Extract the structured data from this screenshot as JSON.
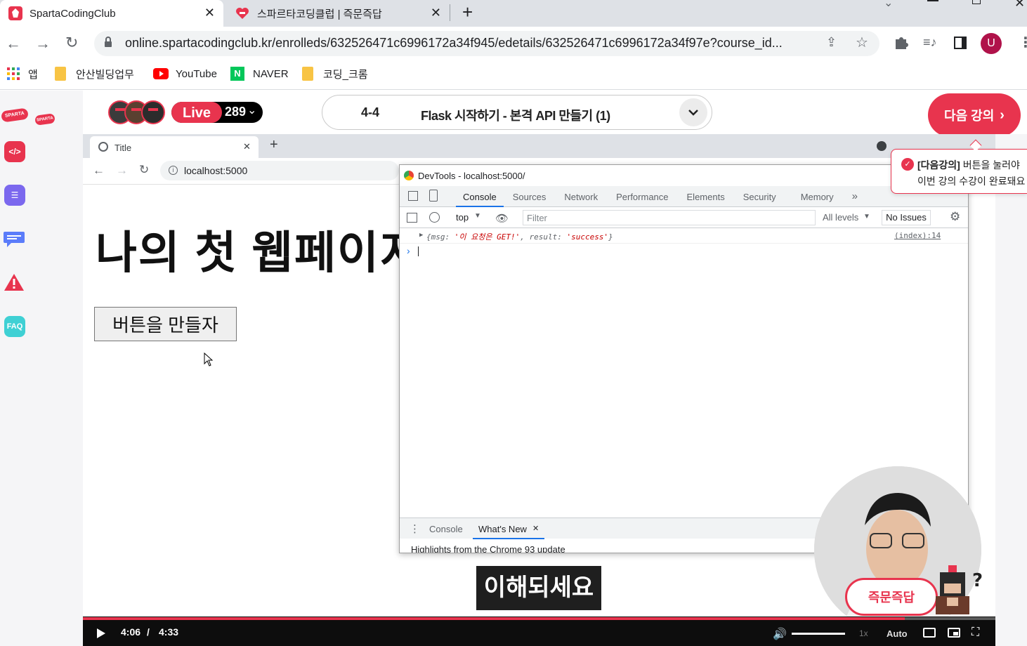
{
  "browser": {
    "tabs": [
      {
        "title": "SpartaCodingClub",
        "icon": "sparta-favicon"
      },
      {
        "title": "스파르타코딩클럽 | 즉문즉답",
        "icon": "heart-chat-favicon"
      }
    ],
    "url": "online.spartacodingclub.kr/enrolleds/632526471c6996172a34f945/edetails/632526471c6996172a34f97e?course_id...",
    "avatar_letter": "U",
    "bookmarks": [
      "앱",
      "안산빌딩업무",
      "YouTube",
      "NAVER",
      "코딩_크롬"
    ]
  },
  "sidebar": {
    "logo_text": "SPARTA",
    "faq_label": "FAQ"
  },
  "header": {
    "live_label": "Live",
    "live_count": "289",
    "lesson_number": "4-4",
    "lesson_title": "Flask 시작하기 - 본격 API 만들기 (1)",
    "next_button": "다음 강의"
  },
  "tooltip": {
    "line1_bold": "[다음강의]",
    "line1_rest": " 버튼을 눌러야",
    "line2": "이번 강의 수강이 완료돼요"
  },
  "inner_browser": {
    "tab_title": "Title",
    "url": "localhost:5000",
    "heading": "나의 첫 웹페이지",
    "button_label": "버튼을 만들자"
  },
  "devtools": {
    "title": "DevTools - localhost:5000/",
    "tabs": [
      "Console",
      "Sources",
      "Network",
      "Performance",
      "Elements",
      "Security",
      "Memory"
    ],
    "context": "top",
    "filter_placeholder": "Filter",
    "levels": "All levels",
    "issues": "No Issues",
    "log_pre": "{msg: ",
    "log_msg": "'이 요청은 GET!'",
    "log_mid": ", result: ",
    "log_result": "'success'",
    "log_post": "}",
    "log_source": "(index):14",
    "drawer_tabs": [
      "Console",
      "What's New"
    ],
    "drawer_text": "Highlights from the Chrome 93 update"
  },
  "player": {
    "subtitle": "이해되세요",
    "current_time": "4:06",
    "separator": "/",
    "duration": "4:33",
    "progress": 0.901,
    "speed": "1x",
    "quality": "Auto",
    "qa_button": "즉문즉답"
  },
  "colors": {
    "brand_red": "#e8344e",
    "progress_red": "#e8344e"
  }
}
